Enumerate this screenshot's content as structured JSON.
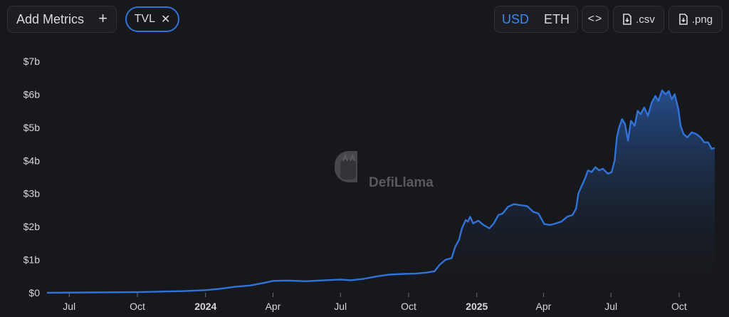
{
  "toolbar": {
    "add_metrics_label": "Add Metrics",
    "add_icon": "plus-icon",
    "metric_chip_label": "TVL",
    "chip_close_icon": "close-icon",
    "currency_options": [
      "USD",
      "ETH"
    ],
    "currency_selected": "USD",
    "embed_icon": "code-icon",
    "csv_label": ".csv",
    "png_label": ".png",
    "download_icon": "file-download-icon"
  },
  "watermark": {
    "text": "DefiLlama",
    "icon": "llama-logo-icon"
  },
  "colors": {
    "line": "#2f73d9",
    "background": "#17181c",
    "active_text": "#3e86ea"
  },
  "chart_data": {
    "type": "area",
    "title": "",
    "xlabel": "",
    "ylabel": "",
    "ylim": [
      0,
      7
    ],
    "y_ticks": [
      0,
      1,
      2,
      3,
      4,
      5,
      6,
      7
    ],
    "y_tick_labels": [
      "$0",
      "$1b",
      "$2b",
      "$3b",
      "$4b",
      "$5b",
      "$6b",
      "$7b"
    ],
    "x_range": [
      "2023-06-01",
      "2025-11-20"
    ],
    "x_ticks": [
      {
        "date": "2023-07-01",
        "label": "Jul",
        "bold": false
      },
      {
        "date": "2023-10-01",
        "label": "Oct",
        "bold": false
      },
      {
        "date": "2024-01-01",
        "label": "2024",
        "bold": true
      },
      {
        "date": "2024-04-01",
        "label": "Apr",
        "bold": false
      },
      {
        "date": "2024-07-01",
        "label": "Jul",
        "bold": false
      },
      {
        "date": "2024-10-01",
        "label": "Oct",
        "bold": false
      },
      {
        "date": "2025-01-01",
        "label": "2025",
        "bold": true
      },
      {
        "date": "2025-04-01",
        "label": "Apr",
        "bold": false
      },
      {
        "date": "2025-07-01",
        "label": "Jul",
        "bold": false
      },
      {
        "date": "2025-10-01",
        "label": "Oct",
        "bold": false
      }
    ],
    "grid": false,
    "series": [
      {
        "unit": "USD billions",
        "points": [
          [
            "2023-06-01",
            0.0
          ],
          [
            "2023-08-01",
            0.01
          ],
          [
            "2023-10-01",
            0.02
          ],
          [
            "2023-12-01",
            0.05
          ],
          [
            "2024-01-01",
            0.08
          ],
          [
            "2024-01-20",
            0.12
          ],
          [
            "2024-02-10",
            0.18
          ],
          [
            "2024-03-01",
            0.22
          ],
          [
            "2024-03-20",
            0.3
          ],
          [
            "2024-04-01",
            0.36
          ],
          [
            "2024-04-20",
            0.37
          ],
          [
            "2024-05-15",
            0.35
          ],
          [
            "2024-06-10",
            0.38
          ],
          [
            "2024-07-01",
            0.4
          ],
          [
            "2024-07-15",
            0.38
          ],
          [
            "2024-08-01",
            0.42
          ],
          [
            "2024-08-20",
            0.5
          ],
          [
            "2024-09-05",
            0.55
          ],
          [
            "2024-09-25",
            0.57
          ],
          [
            "2024-10-10",
            0.58
          ],
          [
            "2024-10-25",
            0.61
          ],
          [
            "2024-11-05",
            0.65
          ],
          [
            "2024-11-12",
            0.85
          ],
          [
            "2024-11-20",
            1.0
          ],
          [
            "2024-11-28",
            1.05
          ],
          [
            "2024-12-03",
            1.4
          ],
          [
            "2024-12-08",
            1.6
          ],
          [
            "2024-12-12",
            1.95
          ],
          [
            "2024-12-17",
            2.2
          ],
          [
            "2024-12-20",
            2.15
          ],
          [
            "2024-12-23",
            2.3
          ],
          [
            "2024-12-27",
            2.1
          ],
          [
            "2025-01-03",
            2.18
          ],
          [
            "2025-01-10",
            2.05
          ],
          [
            "2025-01-18",
            1.95
          ],
          [
            "2025-01-24",
            2.1
          ],
          [
            "2025-01-30",
            2.35
          ],
          [
            "2025-02-05",
            2.4
          ],
          [
            "2025-02-12",
            2.6
          ],
          [
            "2025-02-20",
            2.68
          ],
          [
            "2025-03-01",
            2.65
          ],
          [
            "2025-03-10",
            2.62
          ],
          [
            "2025-03-18",
            2.45
          ],
          [
            "2025-03-25",
            2.4
          ],
          [
            "2025-04-02",
            2.08
          ],
          [
            "2025-04-10",
            2.05
          ],
          [
            "2025-04-18",
            2.1
          ],
          [
            "2025-04-25",
            2.15
          ],
          [
            "2025-05-03",
            2.3
          ],
          [
            "2025-05-10",
            2.35
          ],
          [
            "2025-05-15",
            2.55
          ],
          [
            "2025-05-18",
            3.0
          ],
          [
            "2025-05-22",
            3.2
          ],
          [
            "2025-05-27",
            3.45
          ],
          [
            "2025-05-31",
            3.7
          ],
          [
            "2025-06-05",
            3.65
          ],
          [
            "2025-06-10",
            3.8
          ],
          [
            "2025-06-15",
            3.7
          ],
          [
            "2025-06-20",
            3.75
          ],
          [
            "2025-06-27",
            3.6
          ],
          [
            "2025-07-02",
            3.65
          ],
          [
            "2025-07-06",
            4.0
          ],
          [
            "2025-07-09",
            4.7
          ],
          [
            "2025-07-12",
            5.0
          ],
          [
            "2025-07-16",
            5.25
          ],
          [
            "2025-07-20",
            5.1
          ],
          [
            "2025-07-24",
            4.6
          ],
          [
            "2025-07-28",
            5.2
          ],
          [
            "2025-08-02",
            5.05
          ],
          [
            "2025-08-06",
            5.5
          ],
          [
            "2025-08-10",
            5.4
          ],
          [
            "2025-08-15",
            5.6
          ],
          [
            "2025-08-20",
            5.35
          ],
          [
            "2025-08-25",
            5.75
          ],
          [
            "2025-08-30",
            5.95
          ],
          [
            "2025-09-03",
            5.8
          ],
          [
            "2025-09-08",
            6.12
          ],
          [
            "2025-09-13",
            6.0
          ],
          [
            "2025-09-17",
            6.1
          ],
          [
            "2025-09-21",
            5.85
          ],
          [
            "2025-09-25",
            6.0
          ],
          [
            "2025-09-30",
            5.55
          ],
          [
            "2025-10-03",
            5.05
          ],
          [
            "2025-10-07",
            4.8
          ],
          [
            "2025-10-12",
            4.7
          ],
          [
            "2025-10-18",
            4.85
          ],
          [
            "2025-10-24",
            4.8
          ],
          [
            "2025-10-30",
            4.7
          ],
          [
            "2025-11-04",
            4.55
          ],
          [
            "2025-11-09",
            4.55
          ],
          [
            "2025-11-14",
            4.35
          ],
          [
            "2025-11-18",
            4.38
          ]
        ]
      }
    ]
  }
}
